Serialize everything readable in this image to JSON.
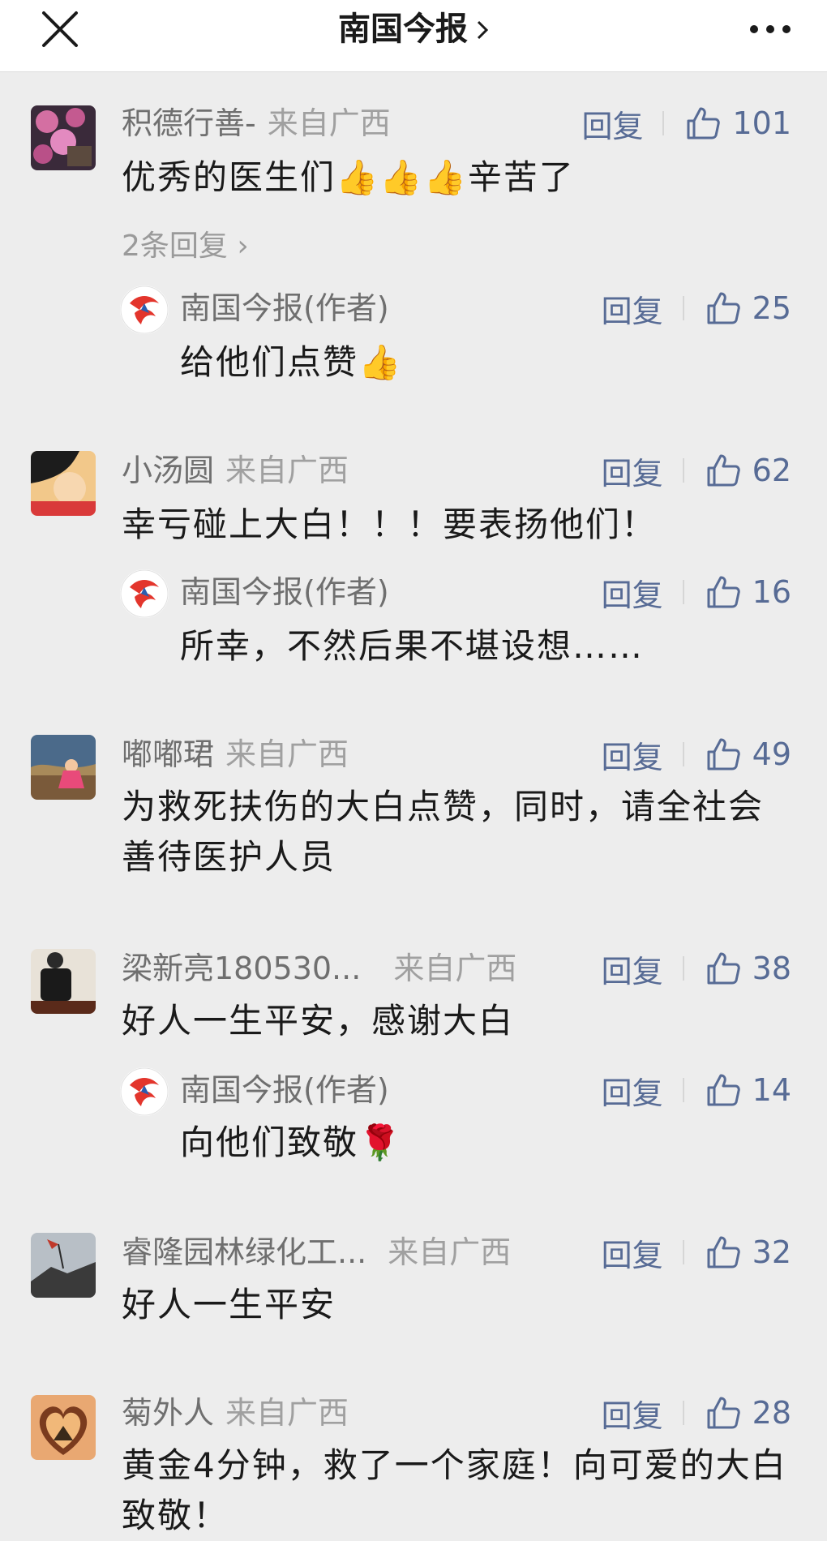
{
  "header": {
    "title": "南国今报",
    "icons": {
      "close": "close-icon",
      "chevron": "chevron-right-icon",
      "more": "more-dots-icon"
    }
  },
  "colors": {
    "link": "#576b95",
    "name": "#6f6f6f",
    "location": "#a0a0a0",
    "background": "#ededed"
  },
  "comments": [
    {
      "name": "积德行善-",
      "location": "来自广西",
      "reply_label": "回复",
      "likes": "101",
      "text": "优秀的医生们👍👍👍辛苦了",
      "more_replies": "2条回复",
      "reply": {
        "name": "南国今报(作者)",
        "reply_label": "回复",
        "likes": "25",
        "text": "给他们点赞👍"
      }
    },
    {
      "name": "小汤圆",
      "location": "来自广西",
      "reply_label": "回复",
      "likes": "62",
      "text": "幸亏碰上大白！！！要表扬他们！",
      "reply": {
        "name": "南国今报(作者)",
        "reply_label": "回复",
        "likes": "16",
        "text": "所幸，不然后果不堪设想……"
      }
    },
    {
      "name": "嘟嘟珺",
      "location": "来自广西",
      "reply_label": "回复",
      "likes": "49",
      "text": "为救死扶伤的大白点赞，同时，请全社会善待医护人员"
    },
    {
      "name": "梁新亮180530...",
      "location": "来自广西",
      "reply_label": "回复",
      "likes": "38",
      "text": "好人一生平安，感谢大白",
      "reply": {
        "name": "南国今报(作者)",
        "reply_label": "回复",
        "likes": "14",
        "text": "向他们致敬🌹"
      }
    },
    {
      "name": "睿隆园林绿化工...",
      "location": "来自广西",
      "reply_label": "回复",
      "likes": "32",
      "text": "好人一生平安"
    },
    {
      "name": "菊外人",
      "location": "来自广西",
      "reply_label": "回复",
      "likes": "28",
      "text": "黄金4分钟，救了一个家庭！向可爱的大白致敬！"
    }
  ]
}
